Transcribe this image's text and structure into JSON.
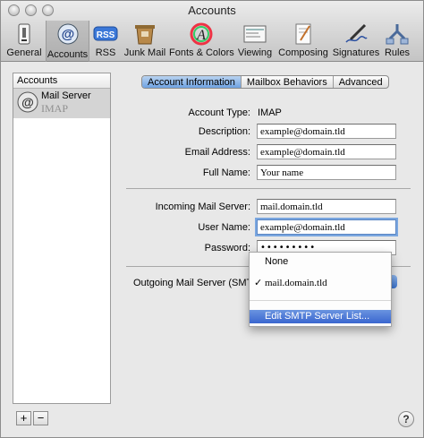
{
  "window": {
    "title": "Accounts"
  },
  "toolbar": {
    "items": [
      {
        "label": "General",
        "icon": "switch-icon"
      },
      {
        "label": "Accounts",
        "icon": "at-icon",
        "selected": true
      },
      {
        "label": "RSS",
        "icon": "rss-icon"
      },
      {
        "label": "Junk Mail",
        "icon": "junk-mail-icon"
      },
      {
        "label": "Fonts & Colors",
        "icon": "fonts-colors-icon"
      },
      {
        "label": "Viewing",
        "icon": "viewing-icon"
      },
      {
        "label": "Composing",
        "icon": "composing-icon"
      },
      {
        "label": "Signatures",
        "icon": "signatures-icon"
      },
      {
        "label": "Rules",
        "icon": "rules-icon"
      }
    ]
  },
  "sidebar": {
    "header": "Accounts",
    "accounts": [
      {
        "name": "Mail Server",
        "type": "IMAP"
      }
    ],
    "add_label": "+",
    "remove_label": "−"
  },
  "tabs": [
    {
      "label": "Account Information",
      "active": true
    },
    {
      "label": "Mailbox Behaviors",
      "active": false
    },
    {
      "label": "Advanced",
      "active": false
    }
  ],
  "form": {
    "account_type_label": "Account Type:",
    "account_type_value": "IMAP",
    "description_label": "Description:",
    "description_value": "example@domain.tld",
    "email_label": "Email Address:",
    "email_value": "example@domain.tld",
    "fullname_label": "Full Name:",
    "fullname_value": "Your name",
    "incoming_label": "Incoming Mail Server:",
    "incoming_value": "mail.domain.tld",
    "username_label": "User Name:",
    "username_value": "example@domain.tld",
    "password_label": "Password:",
    "password_value": "•••••••••",
    "outgoing_label": "Outgoing Mail Server (SMTP):"
  },
  "smtp_menu": {
    "items": [
      {
        "label": "None",
        "checked": false
      },
      {
        "label": "mail.domain.tld",
        "checked": true
      }
    ],
    "edit_label": "Edit SMTP Server List...",
    "check_mark": "✓"
  },
  "help": {
    "label": "?"
  },
  "colors": {
    "accent": "#3a66cf",
    "selection": "#d4d4d4"
  }
}
